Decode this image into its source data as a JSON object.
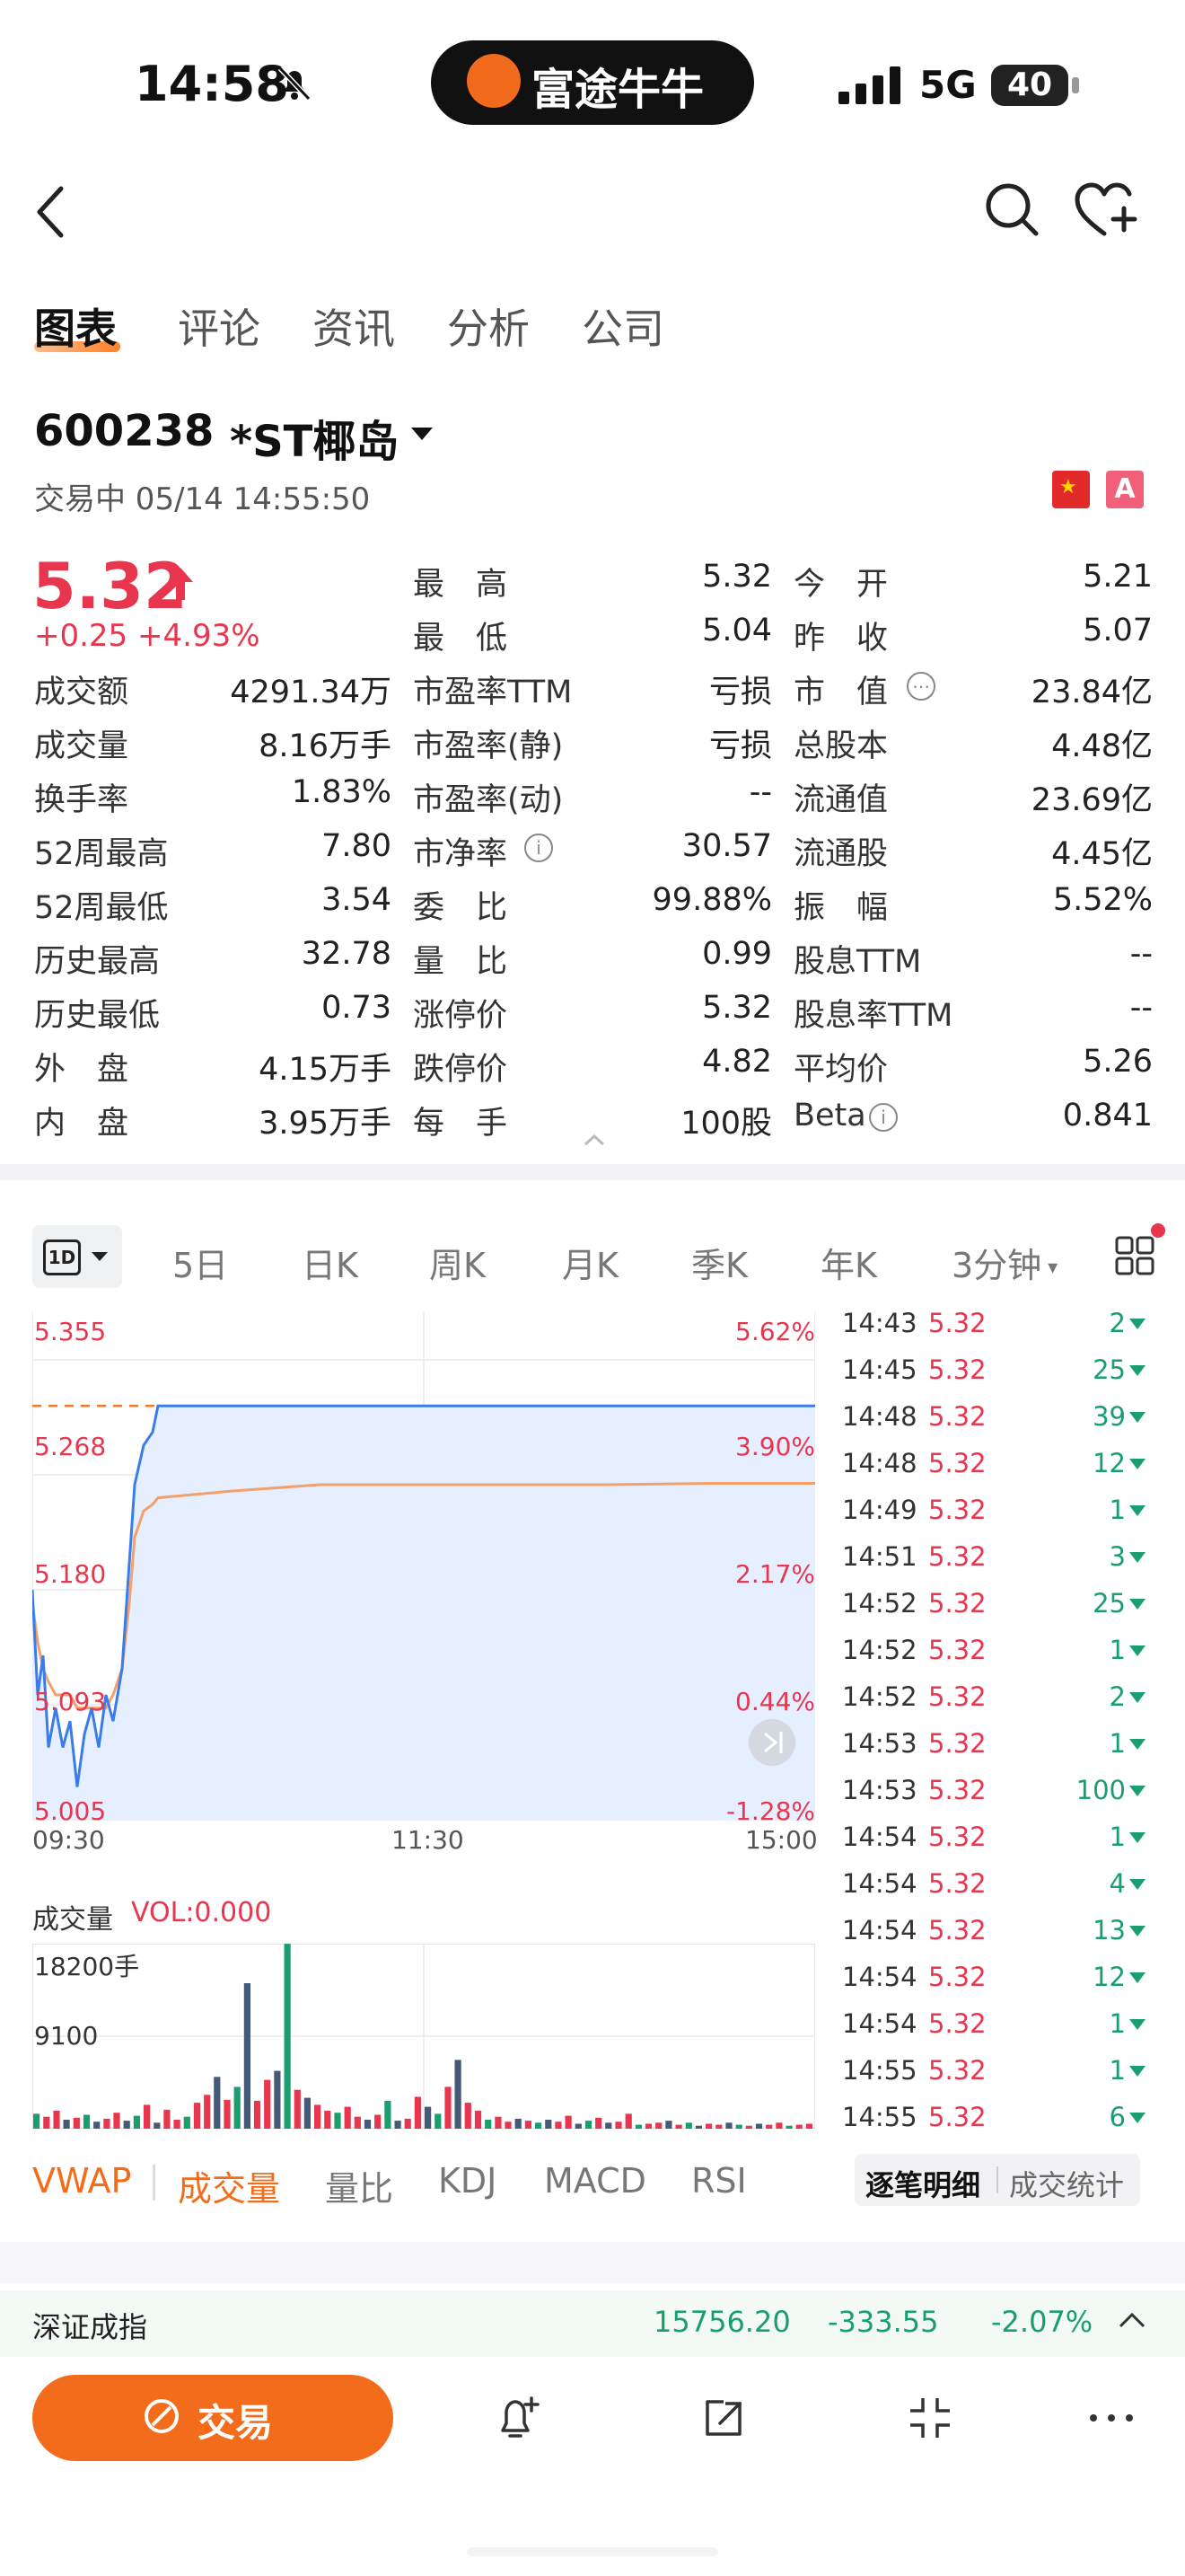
{
  "status_bar": {
    "time": "14:58",
    "app": "富途牛牛",
    "network": "5G",
    "battery": "40"
  },
  "tabs": [
    "图表",
    "评论",
    "资讯",
    "分析",
    "公司"
  ],
  "stock": {
    "code": "600238",
    "name": "*ST椰岛",
    "status": "交易中 05/14 14:55:50",
    "price": "5.32",
    "change": "+0.25",
    "change_pct": "+4.93%",
    "market_flag_text": "A"
  },
  "quote": {
    "row1": {
      "l2": "最　高",
      "v2": "5.32",
      "l3": "今　开",
      "v3": "5.21"
    },
    "row2": {
      "l2": "最　低",
      "v2": "5.04",
      "l3": "昨　收",
      "v3": "5.07"
    },
    "rows": [
      {
        "l1": "成交额",
        "v1": "4291.34万",
        "l2": "市盈率TTM",
        "v2": "亏损",
        "l3": "市　值",
        "v3": "23.84亿"
      },
      {
        "l1": "成交量",
        "v1": "8.16万手",
        "l2": "市盈率(静)",
        "v2": "亏损",
        "l3": "总股本",
        "v3": "4.48亿"
      },
      {
        "l1": "换手率",
        "v1": "1.83%",
        "l2": "市盈率(动)",
        "v2": "--",
        "l3": "流通值",
        "v3": "23.69亿"
      },
      {
        "l1": "52周最高",
        "v1": "7.80",
        "l2": "市净率",
        "v2": "30.57",
        "l3": "流通股",
        "v3": "4.45亿"
      },
      {
        "l1": "52周最低",
        "v1": "3.54",
        "l2": "委　比",
        "v2": "99.88%",
        "l3": "振　幅",
        "v3": "5.52%"
      },
      {
        "l1": "历史最高",
        "v1": "32.78",
        "l2": "量　比",
        "v2": "0.99",
        "l3": "股息TTM",
        "v3": "--"
      },
      {
        "l1": "历史最低",
        "v1": "0.73",
        "l2": "涨停价",
        "v2": "5.32",
        "l3": "股息率TTM",
        "v3": "--"
      },
      {
        "l1": "外　盘",
        "v1": "4.15万手",
        "l2": "跌停价",
        "v2": "4.82",
        "l3": "平均价",
        "v3": "5.26"
      },
      {
        "l1": "内　盘",
        "v1": "3.95万手",
        "l2": "每　手",
        "v2": "100股",
        "l3": "Beta",
        "v3": "0.841"
      }
    ]
  },
  "periods": {
    "selected": "1D",
    "others": [
      "5日",
      "日K",
      "周K",
      "月K",
      "季K",
      "年K"
    ],
    "interval": "3分钟"
  },
  "chart": {
    "y_labels_left": [
      "5.355",
      "5.268",
      "5.180",
      "5.093",
      "5.005"
    ],
    "y_labels_right": [
      "5.62%",
      "3.90%",
      "2.17%",
      "0.44%",
      "-1.28%"
    ],
    "x_labels": [
      "09:30",
      "11:30",
      "15:00"
    ]
  },
  "chart_data": {
    "type": "line",
    "title": "",
    "ylim": [
      5.005,
      5.355
    ],
    "x_range": [
      "09:30",
      "15:00"
    ],
    "limit_up": 5.32,
    "series": [
      {
        "values": [
          5.18,
          5.1,
          5.13,
          5.06,
          5.09,
          5.06,
          5.08,
          5.03,
          5.07,
          5.09,
          5.06,
          5.1,
          5.08,
          5.12,
          5.2,
          5.26,
          5.29,
          5.3,
          5.32,
          5.32,
          5.32,
          5.32,
          5.32,
          5.32,
          5.32,
          5.32
        ]
      },
      {
        "values": [
          5.17,
          5.14,
          5.12,
          5.11,
          5.1,
          5.1,
          5.1,
          5.09,
          5.09,
          5.09,
          5.09,
          5.09,
          5.1,
          5.12,
          5.17,
          5.22,
          5.24,
          5.245,
          5.25,
          5.255,
          5.26,
          5.26,
          5.26,
          5.26,
          5.261,
          5.261
        ]
      }
    ]
  },
  "ticks": [
    {
      "time": "14:43",
      "price": "5.32",
      "vol": "2"
    },
    {
      "time": "14:45",
      "price": "5.32",
      "vol": "25"
    },
    {
      "time": "14:48",
      "price": "5.32",
      "vol": "39"
    },
    {
      "time": "14:48",
      "price": "5.32",
      "vol": "12"
    },
    {
      "time": "14:49",
      "price": "5.32",
      "vol": "1"
    },
    {
      "time": "14:51",
      "price": "5.32",
      "vol": "3"
    },
    {
      "time": "14:52",
      "price": "5.32",
      "vol": "25"
    },
    {
      "time": "14:52",
      "price": "5.32",
      "vol": "1"
    },
    {
      "time": "14:52",
      "price": "5.32",
      "vol": "2"
    },
    {
      "time": "14:53",
      "price": "5.32",
      "vol": "1"
    },
    {
      "time": "14:53",
      "price": "5.32",
      "vol": "100"
    },
    {
      "time": "14:54",
      "price": "5.32",
      "vol": "1"
    },
    {
      "time": "14:54",
      "price": "5.32",
      "vol": "4"
    },
    {
      "time": "14:54",
      "price": "5.32",
      "vol": "13"
    },
    {
      "time": "14:54",
      "price": "5.32",
      "vol": "12"
    },
    {
      "time": "14:54",
      "price": "5.32",
      "vol": "1"
    },
    {
      "time": "14:55",
      "price": "5.32",
      "vol": "1"
    },
    {
      "time": "14:55",
      "price": "5.32",
      "vol": "6"
    }
  ],
  "volume": {
    "title": "成交量",
    "reading": "VOL:0.000",
    "axis": [
      "18200手",
      "9100"
    ],
    "ymax": 18200,
    "bars": [
      1500,
      1200,
      1800,
      900,
      1100,
      1400,
      700,
      1000,
      1600,
      800,
      1300,
      2400,
      600,
      1900,
      900,
      1200,
      2600,
      3400,
      5200,
      2900,
      4200,
      14600,
      2800,
      4900,
      5800,
      20000,
      3900,
      3100,
      2400,
      1800,
      1600,
      2200,
      1200,
      900,
      1400,
      2800,
      800,
      1000,
      3200,
      2200,
      1500,
      4200,
      6900,
      2600,
      1800,
      900,
      1200,
      700,
      1000,
      800,
      600,
      900,
      700,
      1300,
      500,
      800,
      1100,
      600,
      700,
      1500,
      400,
      500,
      600,
      800,
      400,
      600,
      300,
      500,
      400,
      600,
      400,
      300,
      500,
      400,
      600,
      300,
      400,
      500
    ]
  },
  "indicators": [
    "VWAP",
    "成交量",
    "量比",
    "KDJ",
    "MACD",
    "RSI"
  ],
  "segments": [
    "逐笔明细",
    "成交统计"
  ],
  "index_bar": {
    "name": "深证成指",
    "value": "15756.20",
    "change": "-333.55",
    "pct": "-2.07%"
  },
  "bottom": {
    "trade": "交易"
  }
}
